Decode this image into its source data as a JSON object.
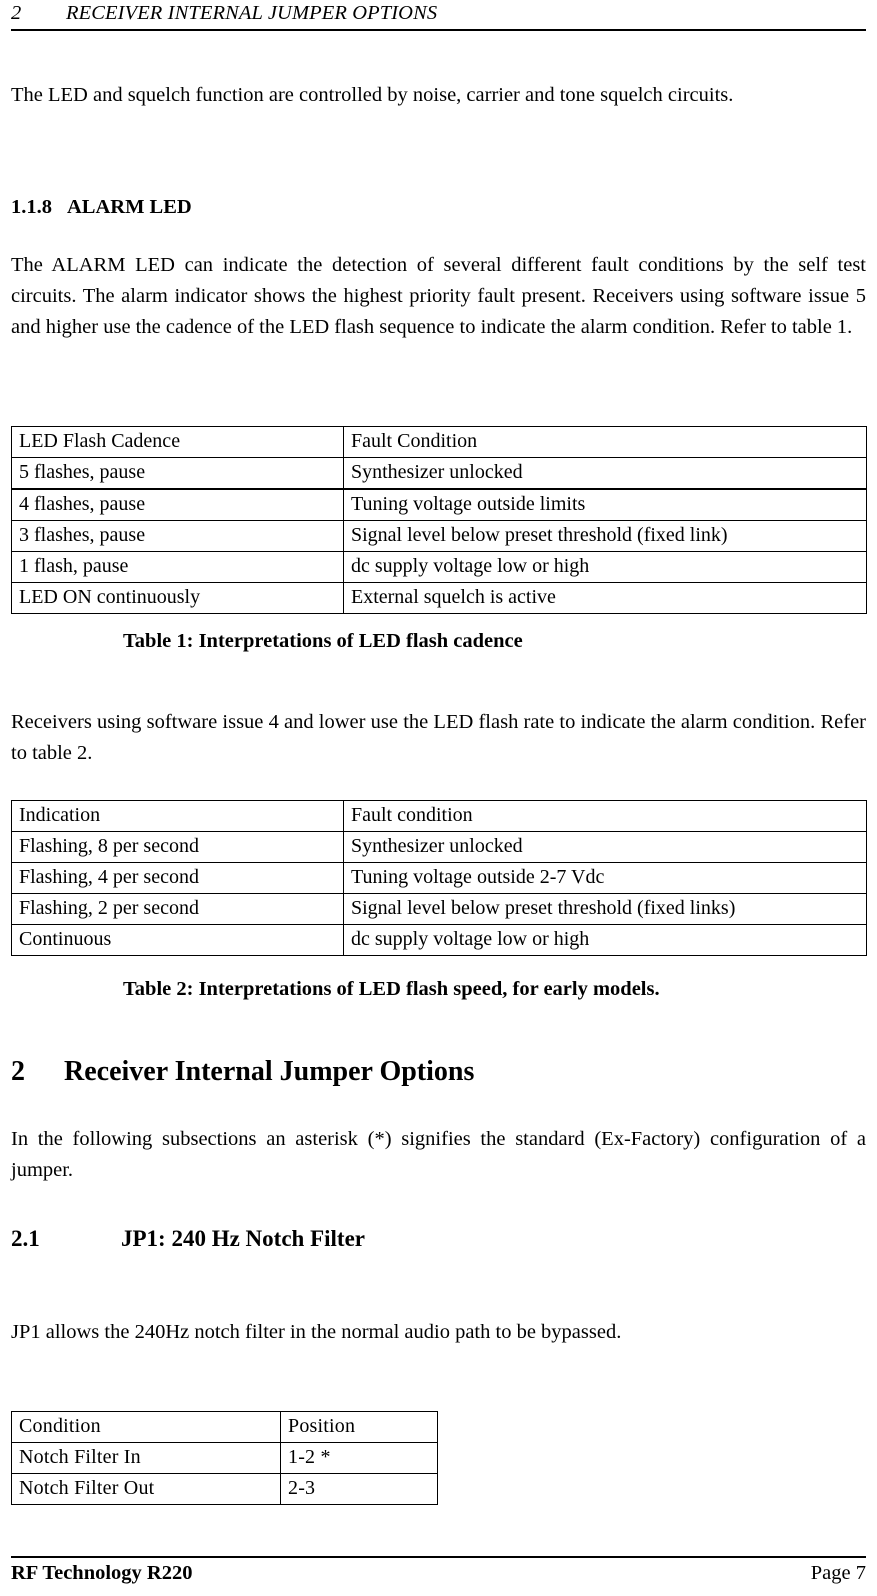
{
  "running_head": {
    "number": "2",
    "title": "RECEIVER INTERNAL JUMPER OPTIONS"
  },
  "body": {
    "intro_paragraph": "The LED and squelch function are controlled by noise, carrier and tone squelch circuits.",
    "alarm_led_heading": {
      "number": "1.1.8",
      "title": "ALARM LED"
    },
    "alarm_led_paragraph": "The ALARM LED can indicate the detection of several different fault conditions by the self test circuits. The alarm indicator shows the highest priority fault present. Receivers using software issue 5 and higher use the cadence of the LED flash sequence to indicate the alarm condition.  Refer to table 1.",
    "early_models_paragraph": " Receivers using software issue 4 and lower use the LED flash rate to indicate the alarm condition.  Refer to table 2.",
    "section2_heading": {
      "number": "2",
      "title": "Receiver Internal Jumper Options"
    },
    "section2_paragraph": "In the following subsections an asterisk (*) signifies the standard (Ex-Factory) configuration of a jumper.",
    "section21_heading": {
      "number": "2.1",
      "title": "JP1: 240 Hz Notch Filter"
    },
    "section21_paragraph": "JP1 allows the 240Hz notch filter in the normal audio path to be bypassed."
  },
  "table_cadence": {
    "caption": "Table 1:  Interpretations of LED flash cadence",
    "headers": [
      "LED Flash Cadence",
      "Fault Condition"
    ],
    "rows": [
      [
        "5 flashes, pause",
        "Synthesizer unlocked"
      ],
      [
        "4 flashes, pause",
        "Tuning voltage outside limits"
      ],
      [
        "3 flashes, pause",
        "Signal level below preset threshold (fixed link)"
      ],
      [
        "1 flash, pause",
        "dc supply voltage low or high"
      ],
      [
        "LED ON continuously",
        "External squelch is active"
      ]
    ]
  },
  "table_speed": {
    "caption": "Table 2:  Interpretations of LED flash speed, for early models.",
    "headers": [
      "Indication",
      "Fault condition"
    ],
    "rows": [
      [
        "Flashing, 8 per second",
        "Synthesizer unlocked"
      ],
      [
        "Flashing, 4 per second",
        "Tuning voltage outside 2-7 Vdc"
      ],
      [
        "Flashing, 2 per second",
        "Signal level below preset threshold (fixed links)"
      ],
      [
        "Continuous",
        "dc supply voltage low or high"
      ]
    ]
  },
  "table_jp1": {
    "headers": [
      "Condition",
      "Position"
    ],
    "rows": [
      [
        "Notch Filter In",
        "1-2 *"
      ],
      [
        "Notch Filter Out",
        "2-3"
      ]
    ]
  },
  "footer": {
    "left": "RF Technology   R220",
    "right": "Page 7"
  }
}
